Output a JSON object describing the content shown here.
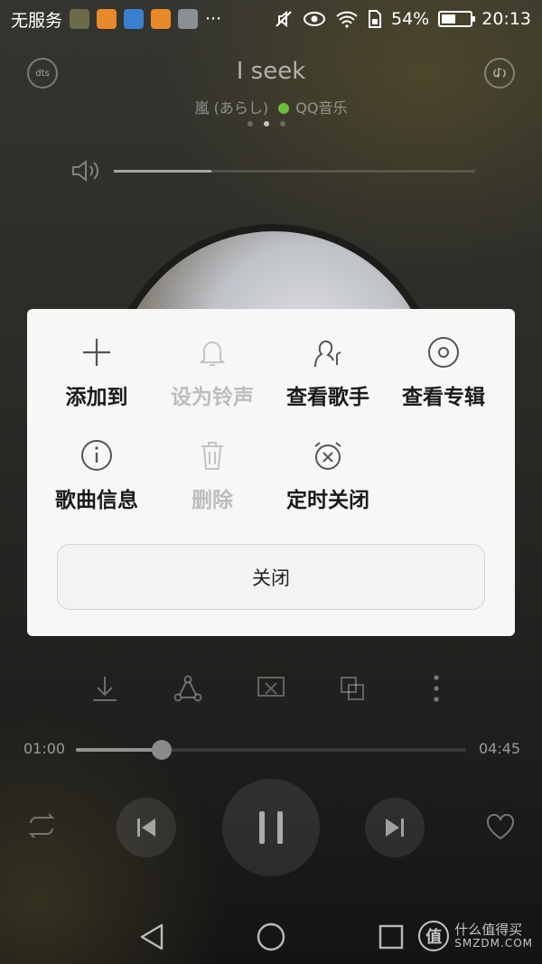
{
  "status_bar": {
    "carrier": "无服务",
    "battery": "54%",
    "battery_level": 0.54,
    "time": "20:13",
    "more": "···"
  },
  "player": {
    "left_button": "dts",
    "title": "I seek",
    "artist": "嵐 (あらし)",
    "source": "QQ音乐",
    "volume_level": 0.27,
    "progress": {
      "current": "01:00",
      "total": "04:45",
      "fraction": 0.22
    }
  },
  "menu": {
    "items": [
      {
        "label": "添加到",
        "icon": "plus-icon",
        "disabled": false
      },
      {
        "label": "设为铃声",
        "icon": "bell-icon",
        "disabled": true
      },
      {
        "label": "查看歌手",
        "icon": "singer-icon",
        "disabled": false
      },
      {
        "label": "查看专辑",
        "icon": "album-disc-icon",
        "disabled": false
      },
      {
        "label": "歌曲信息",
        "icon": "info-icon",
        "disabled": false
      },
      {
        "label": "删除",
        "icon": "trash-icon",
        "disabled": true
      },
      {
        "label": "定时关闭",
        "icon": "alarm-off-icon",
        "disabled": false
      }
    ],
    "close_label": "关闭"
  },
  "watermark": {
    "logo_char": "值",
    "line1": "什么值得买",
    "line2": "SMZDM.COM"
  },
  "colors": {
    "dialog_bg": "#f7f7f7",
    "disabled_text": "#bdbdbd",
    "accent": "#ffffff"
  }
}
